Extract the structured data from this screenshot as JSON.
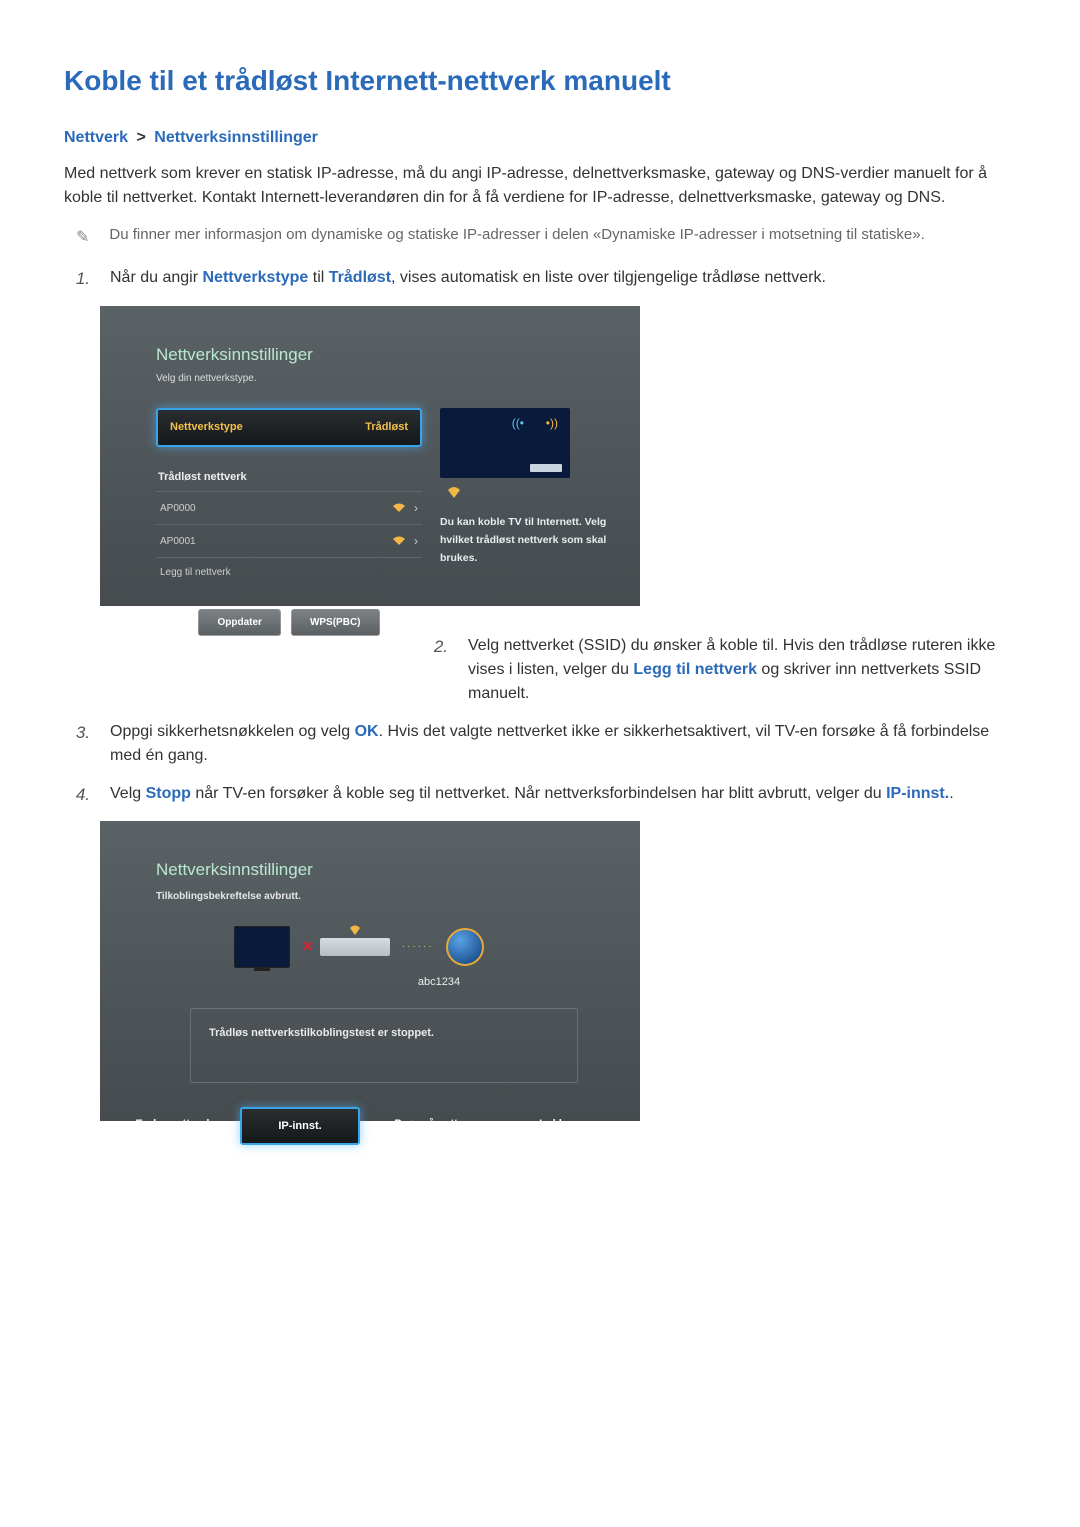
{
  "title": "Koble til et trådløst Internett-nettverk manuelt",
  "breadcrumb": {
    "a": "Nettverk",
    "sep": ">",
    "b": "Nettverksinnstillinger"
  },
  "intro": "Med nettverk som krever en statisk IP-adresse, må du angi IP-adresse, delnettverksmaske, gateway og DNS-verdier manuelt for å koble til nettverket. Kontakt Internett-leverandøren din for å få verdiene for IP-adresse, delnettverksmaske, gateway og DNS.",
  "note": "Du finner mer informasjon om dynamiske og statiske IP-adresser i delen «Dynamiske IP-adresser i motsetning til statiske».",
  "step1": {
    "pre": "Når du angir ",
    "kw1": "Nettverkstype",
    "mid": " til ",
    "kw2": "Trådløst",
    "post": ", vises automatisk en liste over tilgjengelige trådløse nettverk."
  },
  "tv1": {
    "title": "Nettverksinnstillinger",
    "subtitle": "Velg din nettverkstype.",
    "selector_label": "Nettverkstype",
    "selector_value": "Trådløst",
    "section": "Trådløst nettverk",
    "nets": [
      "AP0000",
      "AP0001"
    ],
    "add": "Legg til nettverk",
    "btn_refresh": "Oppdater",
    "btn_wps": "WPS(PBC)",
    "right_text": "Du kan koble TV til Internett. Velg hvilket trådløst nettverk som skal brukes."
  },
  "step2": {
    "pre": "Velg nettverket (SSID) du ønsker å koble til. Hvis den trådløse ruteren ikke vises i listen, velger du ",
    "kw": "Legg til nettverk",
    "post": " og skriver inn nettverkets SSID manuelt."
  },
  "step3": {
    "pre": "Oppgi sikkerhetsnøkkelen og velg ",
    "kw": "OK",
    "post": ". Hvis det valgte nettverket ikke er sikkerhetsaktivert, vil TV-en forsøke å få forbindelse med én gang."
  },
  "step4": {
    "pre": "Velg ",
    "kw1": "Stopp",
    "mid": " når TV-en forsøker å koble seg til nettverket. Når nettverksforbindelsen har blitt avbrutt, velger du ",
    "kw2": "IP-innst.",
    "post": "."
  },
  "tv2": {
    "title": "Nettverksinnstillinger",
    "subtitle": "Tilkoblingsbekreftelse avbrutt.",
    "ssid": "abc1234",
    "msg": "Trådløs nettverkstilkoblingstest er stoppet.",
    "buttons": [
      "Endre nettverk",
      "IP-innst.",
      "Prøv på nytt",
      "Lukk"
    ]
  }
}
